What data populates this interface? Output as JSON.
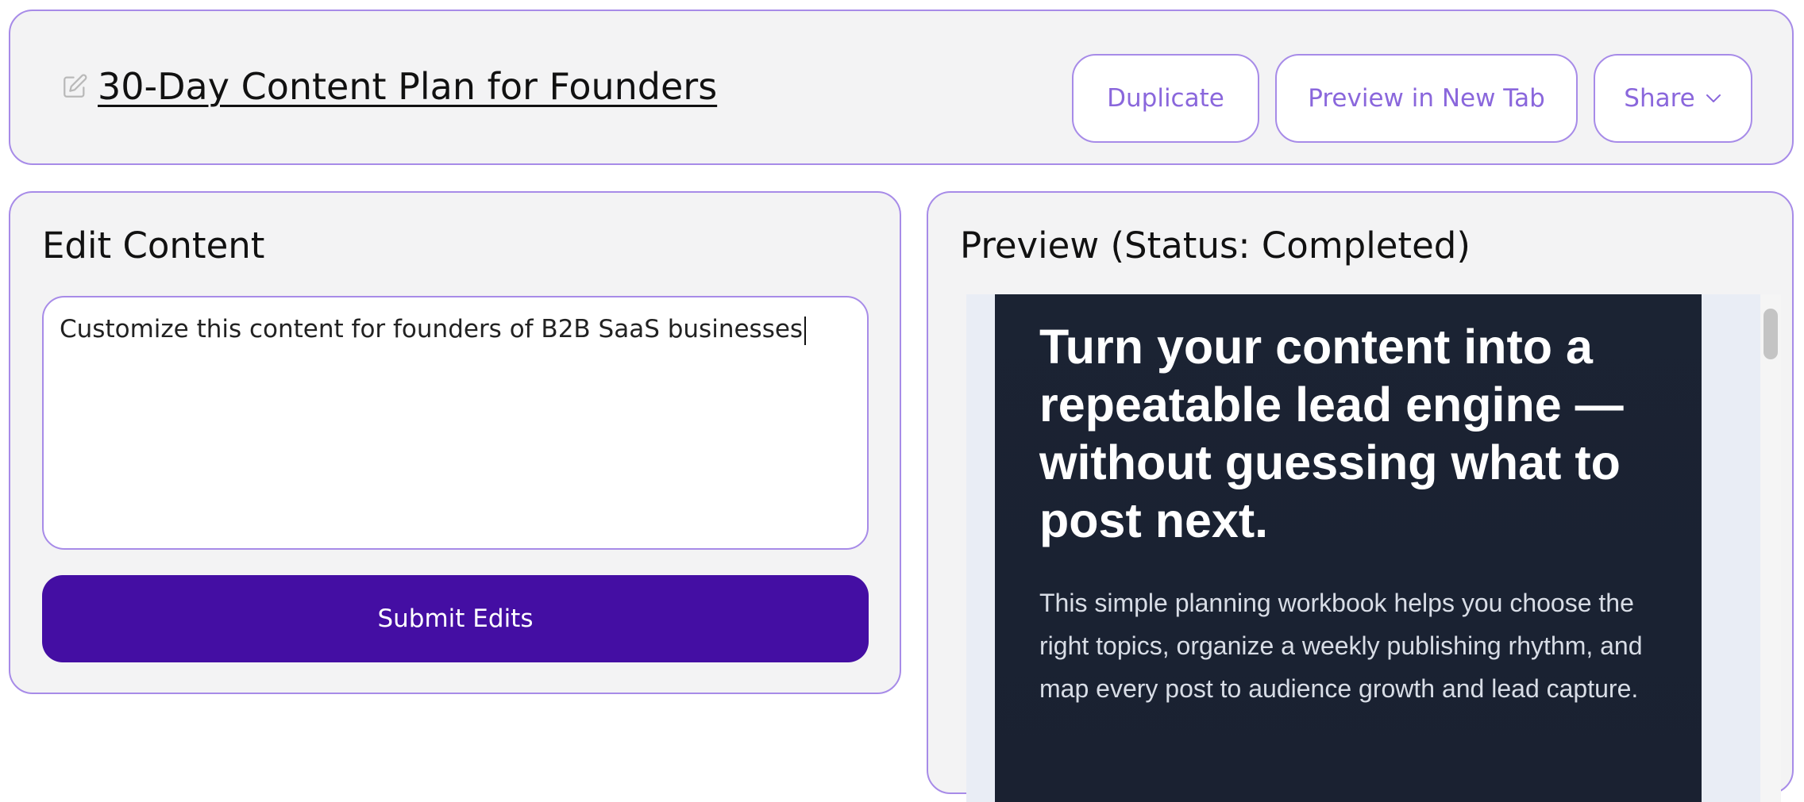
{
  "header": {
    "title": "30-Day Content Plan for Founders",
    "buttons": {
      "duplicate": "Duplicate",
      "preview_new_tab": "Preview in New Tab",
      "share": "Share"
    }
  },
  "edit_panel": {
    "title": "Edit Content",
    "input_value": "Customize this content for founders of B2B SaaS businesses",
    "submit_label": "Submit Edits"
  },
  "preview_panel": {
    "title": "Preview (Status: Completed)",
    "headline": "Turn your content into a repeatable lead engine — without guessing what to post next.",
    "body": "This simple planning workbook helps you choose the right topics, organize a weekly publishing rhythm, and map every post to audience growth and lead capture."
  },
  "icons": {
    "edit": "edit-icon",
    "share_dropdown": "chevron-down-icon"
  },
  "colors": {
    "accent_border": "#a78be8",
    "accent_text": "#8a67dc",
    "primary_button": "#440ea3",
    "panel_background": "#f3f3f4",
    "preview_background": "#1b2333"
  }
}
